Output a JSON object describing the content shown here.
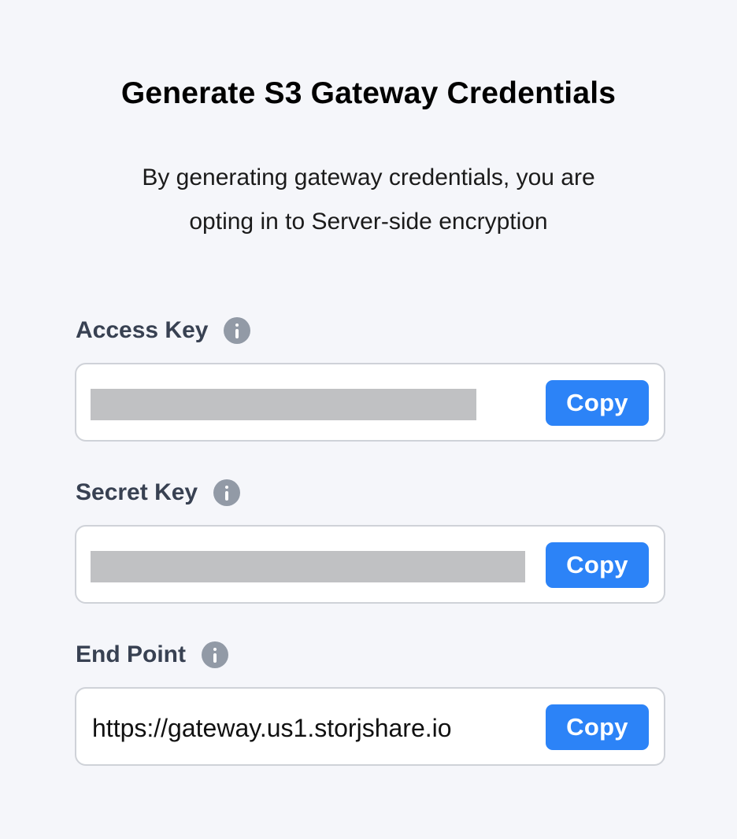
{
  "title": "Generate S3 Gateway Credentials",
  "subtitle_line1": "By generating gateway credentials, you are",
  "subtitle_line2": "opting in to Server-side encryption",
  "fields": [
    {
      "label": "Access Key",
      "value_redacted": true,
      "copy_label": "Copy",
      "info_icon": "info-icon"
    },
    {
      "label": "Secret Key",
      "value_redacted": true,
      "copy_label": "Copy",
      "info_icon": "info-icon"
    },
    {
      "label": "End Point",
      "value": "https://gateway.us1.storjshare.io",
      "copy_label": "Copy",
      "info_icon": "info-icon"
    }
  ],
  "colors": {
    "background": "#f5f6fa",
    "accent": "#2c83f7",
    "label": "#384152",
    "info_icon": "#929aa6",
    "redaction": "#c0c1c3"
  }
}
